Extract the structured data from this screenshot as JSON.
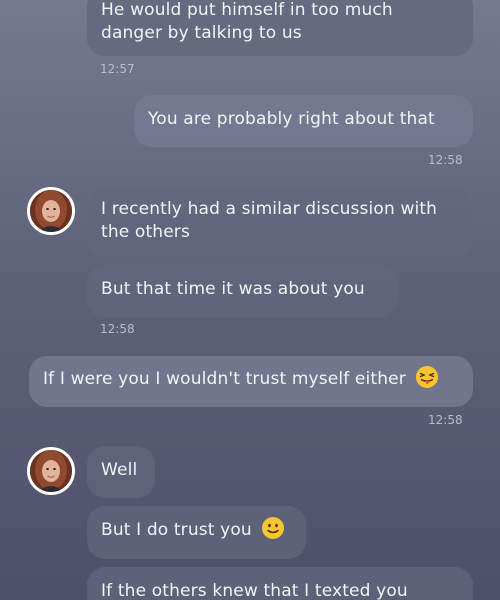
{
  "messages": [
    {
      "side": "in",
      "lines": [
        "He would put himself in too much",
        "danger by talking to us"
      ]
    },
    {
      "side": "in",
      "time": "12:57"
    },
    {
      "side": "out",
      "text": "You are probably right about that",
      "time": "12:58"
    },
    {
      "side": "in",
      "lines": [
        "I recently had a similar discussion with",
        "the others"
      ]
    },
    {
      "side": "in",
      "text": "But that time it was about you",
      "time": "12:58"
    },
    {
      "side": "out",
      "text": "If I were you I wouldn't trust myself either",
      "emoji": "winking-tongue-emoji",
      "time": "12:58"
    },
    {
      "side": "in",
      "text": "Well"
    },
    {
      "side": "in",
      "text": "But I do trust you",
      "emoji": "smiling-emoji"
    },
    {
      "side": "in",
      "text": "If the others knew that I texted you"
    }
  ],
  "icons": {
    "avatar_1": "contact-avatar",
    "avatar_2": "contact-avatar"
  }
}
